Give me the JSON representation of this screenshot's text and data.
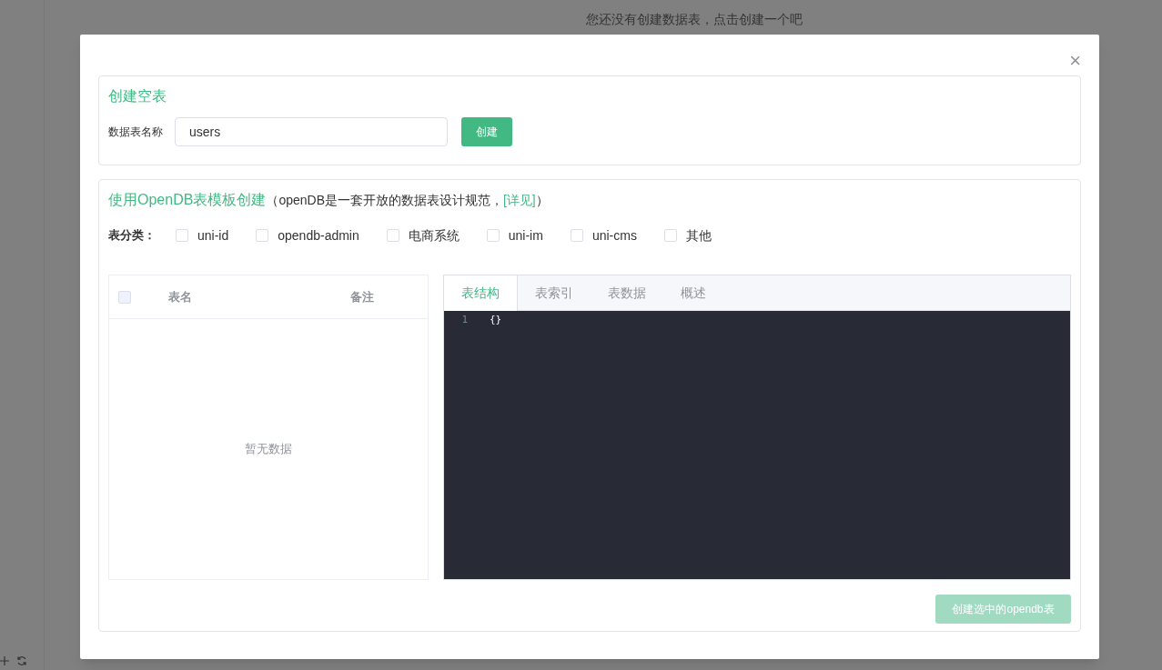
{
  "background_page": {
    "empty_message": "您还没有创建数据表，点击创建一个吧",
    "sidebar_tools": [
      {
        "kind": "add"
      },
      {
        "kind": "refresh"
      }
    ]
  },
  "dialog": {
    "close_label": "×",
    "empty_table_section": {
      "title": "创建空表",
      "name_label": "数据表名称",
      "name_value": "users",
      "create_button": "创建"
    },
    "template_section": {
      "title": "使用OpenDB表模板创建",
      "note_before": "（openDB是一套开放的数据表设计规范，",
      "note_link": "[详见]",
      "note_after": "）",
      "category_label": "表分类：",
      "categories": [
        {
          "label": "uni-id",
          "checked": false
        },
        {
          "label": "opendb-admin",
          "checked": false
        },
        {
          "label": "电商系统",
          "checked": false
        },
        {
          "label": "uni-im",
          "checked": false
        },
        {
          "label": "uni-cms",
          "checked": false
        },
        {
          "label": "其他",
          "checked": false
        }
      ],
      "table": {
        "select_all_checked": false,
        "columns": [
          "表名",
          "备注"
        ],
        "empty_text": "暂无数据"
      },
      "tabs": [
        {
          "label": "表结构",
          "selected": true
        },
        {
          "label": "表索引",
          "selected": false
        },
        {
          "label": "表数据",
          "selected": false
        },
        {
          "label": "概述",
          "selected": false
        }
      ],
      "editor": {
        "lines": [
          {
            "number": "1",
            "code": "{}"
          }
        ]
      },
      "submit_button": {
        "label": "创建选中的opendb表",
        "disabled": true
      }
    }
  }
}
